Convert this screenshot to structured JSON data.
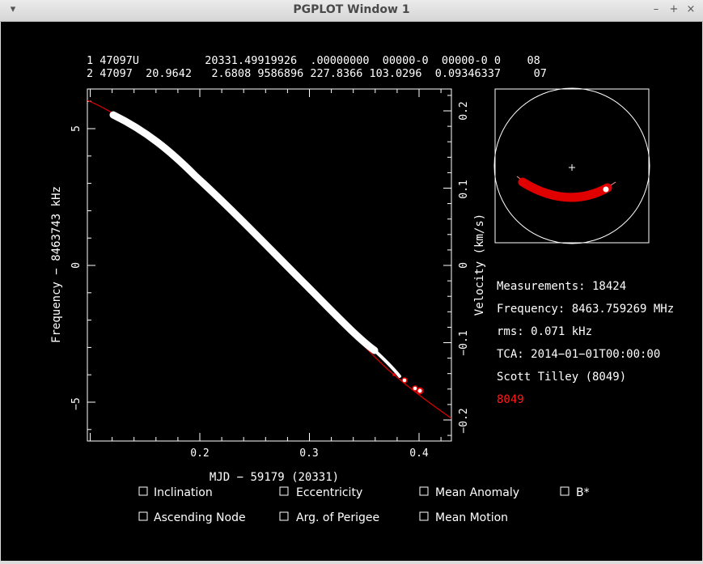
{
  "window": {
    "title": "PGPLOT Window 1",
    "menu_icon": "chevron-down-icon",
    "minimize_label": "–",
    "maximize_label": "+",
    "close_label": "×"
  },
  "tle": {
    "line1": "1 47097U          20331.49919926  .00000000  00000-0  00000-0 0    08",
    "line2": "2 47097  20.9642   2.6808 9586896 227.8366 103.0296  0.09346337     07"
  },
  "plot": {
    "xlabel": "MJD − 59179 (20331)",
    "ylabel_left": "Frequency − 8463743 kHz",
    "ylabel_right": "Velocity (km/s)",
    "x_ticks": [
      "0.2",
      "0.3",
      "0.4"
    ],
    "y_left_ticks": [
      "5",
      "0",
      "−5"
    ],
    "y_right_ticks": [
      "0.2",
      "0.1",
      "0",
      "−0.1",
      "−0.2"
    ]
  },
  "info": {
    "measurements": "Measurements: 18424",
    "frequency": "Frequency: 8463.759269 MHz",
    "rms": "rms: 0.071 kHz",
    "tca": "TCA: 2014−01−01T00:00:00",
    "observer": "Scott Tilley (8049)",
    "site": "8049"
  },
  "checkboxes": [
    {
      "label": "Inclination",
      "checked": false
    },
    {
      "label": "Eccentricity",
      "checked": false
    },
    {
      "label": "Mean Anomaly",
      "checked": false
    },
    {
      "label": "B*",
      "checked": false
    },
    {
      "label": "Ascending Node",
      "checked": false
    },
    {
      "label": "Arg. of Perigee",
      "checked": false
    },
    {
      "label": "Mean Motion",
      "checked": false
    }
  ],
  "colors": {
    "background": "#000000",
    "data": "#ffffff",
    "model": "#ff0000",
    "site": "#ff1a1a"
  }
}
